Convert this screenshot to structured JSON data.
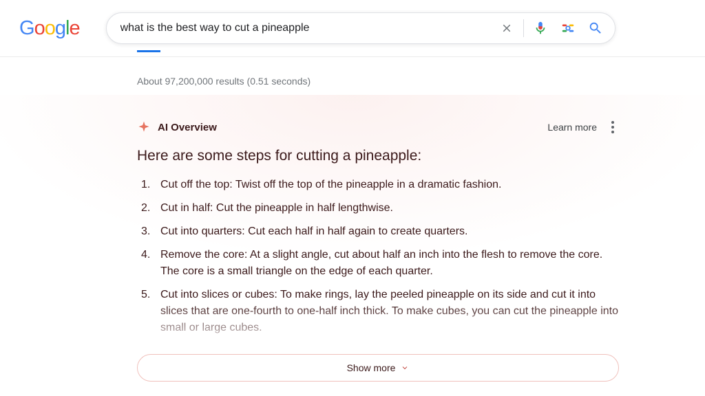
{
  "logo": {
    "g1": "G",
    "o1": "o",
    "o2": "o",
    "g2": "g",
    "l": "l",
    "e": "e"
  },
  "search": {
    "query": "what is the best way to cut a pineapple"
  },
  "results_stats": "About 97,200,000 results (0.51 seconds)",
  "ai_overview": {
    "label": "AI Overview",
    "learn_more": "Learn more",
    "heading": "Here are some steps for cutting a pineapple:",
    "steps": [
      "Cut off the top: Twist off the top of the pineapple in a dramatic fashion.",
      "Cut in half: Cut the pineapple in half lengthwise.",
      "Cut into quarters: Cut each half in half again to create quarters.",
      "Remove the core: At a slight angle, cut about half an inch into the flesh to remove the core. The core is a small triangle on the edge of each quarter.",
      "Cut into slices or cubes: To make rings, lay the peeled pineapple on its side and cut it into slices that are one-fourth to one-half inch thick. To make cubes, you can cut the pineapple into small or large cubes."
    ],
    "show_more": "Show more"
  }
}
